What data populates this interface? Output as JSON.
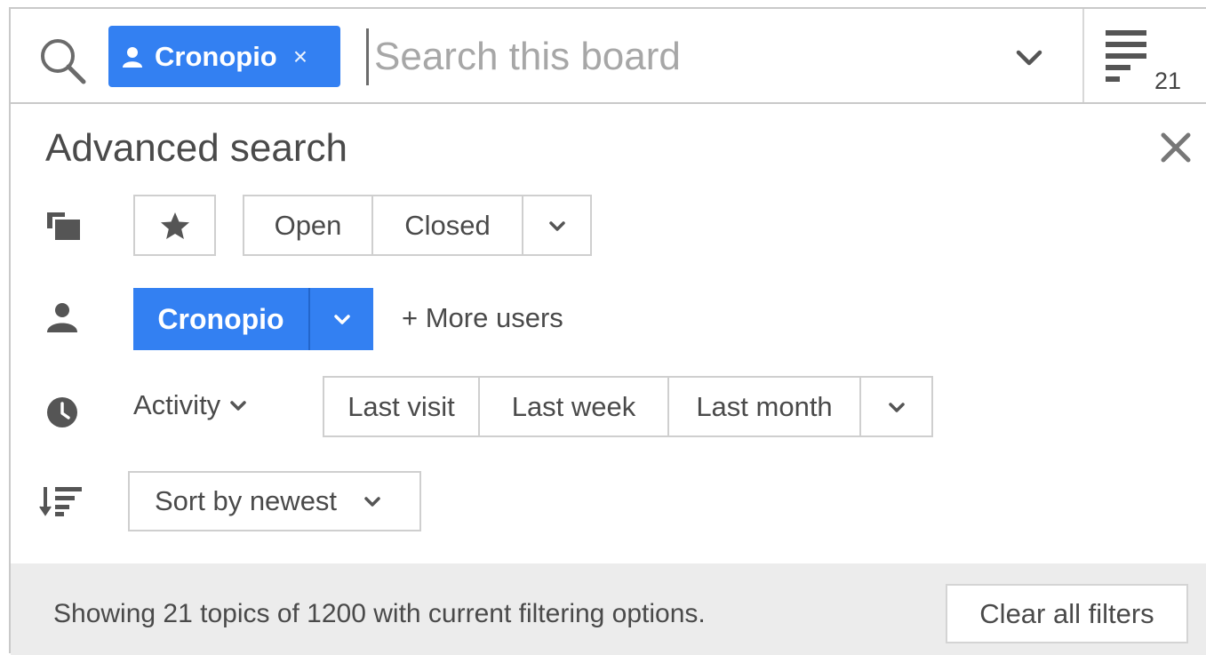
{
  "search": {
    "user_chip_label": "Cronopio",
    "chip_remove": "×",
    "placeholder": "Search this board",
    "topic_count": "21"
  },
  "advanced": {
    "title": "Advanced search",
    "status_buttons": [
      "Open",
      "Closed"
    ],
    "user_label": "Cronopio",
    "more_users": "+ More users",
    "activity_label": "Activity",
    "time_buttons": [
      "Last visit",
      "Last week",
      "Last month"
    ],
    "sort_label": "Sort by newest"
  },
  "footer": {
    "status_text": "Showing 21 topics of 1200 with current filtering options.",
    "clear_label": "Clear all filters"
  },
  "icons": {
    "search": "search-icon",
    "user": "user-icon",
    "topics": "topics-icon",
    "star": "star-icon",
    "clock": "clock-icon",
    "sort": "sort-icon",
    "close": "close-icon",
    "list": "list-icon",
    "chevron": "chevron-down-icon"
  },
  "colors": {
    "accent": "#3380f2",
    "text": "#4a4a4a",
    "border": "#cfcfcf",
    "footer_bg": "#ececec"
  }
}
